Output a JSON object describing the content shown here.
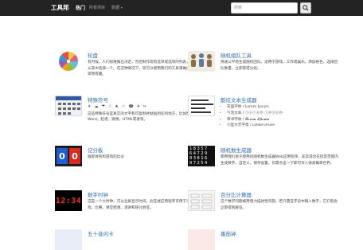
{
  "navbar": {
    "brand": "工具邦",
    "hot": "热门",
    "all_items": "所有项目",
    "data": "数据",
    "search_placeholder": "搜索"
  },
  "cards": [
    {
      "title": "轮盘",
      "desc": "有时候，人们很难做出决定。然后制作现有选项或选项的列表，然后随机从其中选择一个。在这种情况下，您可以使用我们的工具来做出决定。简单而有趣。"
    },
    {
      "title": "随机组队工具",
      "desc": "快速公平地生成随机团队。适用于游戏、工作或娱乐。添加姓名，选择团队数量，立即获得分组。"
    },
    {
      "title": "特殊符号",
      "icons": "☀ ☁ ☂ ☃ ★ ☆ ☎ ✈ ✂",
      "desc": "这些特殊符号是真实的文字和可复制并粘贴到任何地方，比如像微软的Word，脸谱，微博，HTML或者等。"
    },
    {
      "title": "酷炫文本生成器",
      "list": [
        "花里字体 / Lorem Ipsum",
        "气泡文本 / ⓛⓞⓡⓔⓜ ⓘⓟⓢⓤⓜ",
        "草书字体 / 𝓛𝓸𝓻𝓮𝓶 𝓘𝓹𝓼𝓾𝓶",
        "小型大写字母 / ʟᴏʀᴇᴍ ɪᴘsᴜᴍ"
      ]
    },
    {
      "title": "记分板",
      "desc": "跟踪体育和游戏的比分"
    },
    {
      "title": "随机数生成器",
      "desc": "使用我们易于使用的随机数生成器Web应用程序，非常适合在指定范围内生成数字。自定义，保存设置，仅需点击一下即可深入探索概率世界。"
    },
    {
      "title": "数字时钟",
      "desc": "这是一个大时钟，可以全屏显示时间。此在线应用程序可用于活动、游戏、比赛、课堂授课、演讲和研讨会等。"
    },
    {
      "title": "百分比计算器",
      "desc": "这个数学问题被用电力描述性问题，若只需在字段中输入数字，它们就会立即得到解答。"
    },
    {
      "title": "五十音闪卡",
      "desc": ""
    },
    {
      "title": "番茄钟",
      "desc": ""
    }
  ],
  "thumbs": {
    "clock_text": "12:34",
    "scoreboard_left": "0",
    "scoreboard_right": "0",
    "random_digits": [
      "18357",
      "64729",
      "03816",
      "97254"
    ]
  },
  "colors": {
    "navbar": "#232323",
    "link": "#2a6fba",
    "clock_digits": "#ff2a2a",
    "score_blue": "#1e5fd9",
    "score_red": "#e0281f"
  }
}
